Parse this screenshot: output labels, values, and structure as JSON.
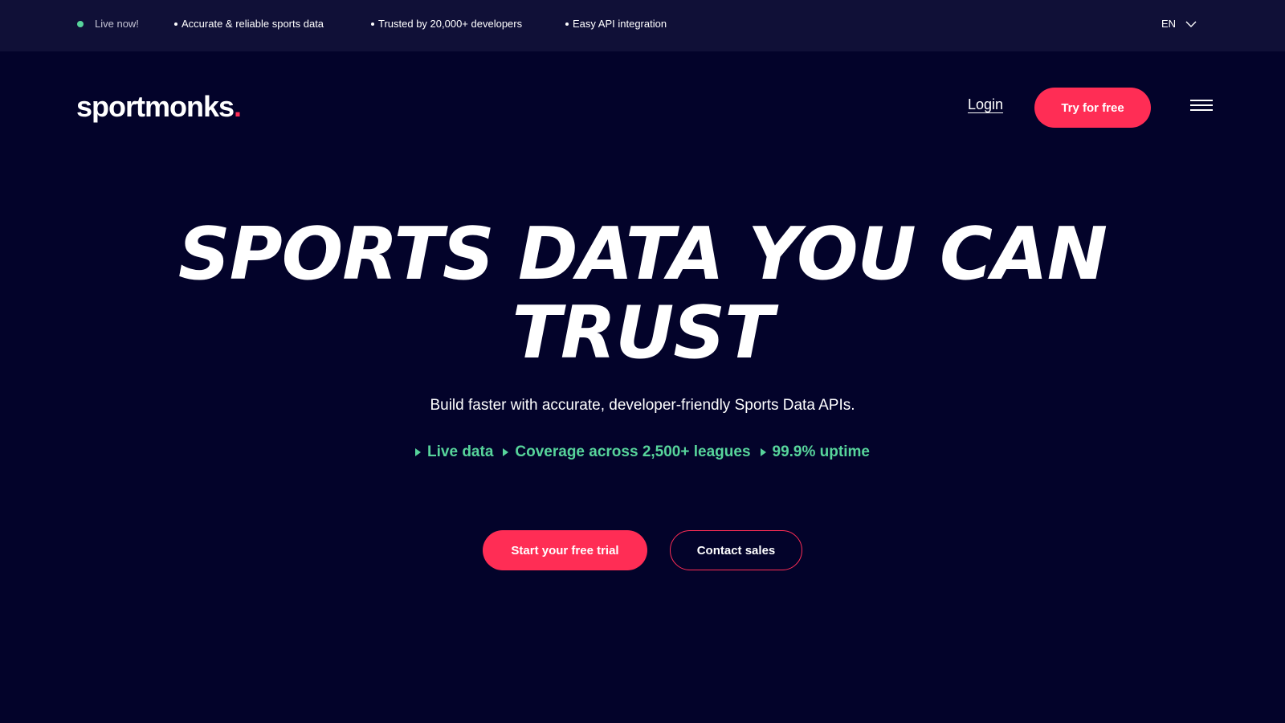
{
  "topbar": {
    "live_label": "Live now!",
    "features": [
      "Accurate & reliable sports data",
      "Trusted by 20,000+ developers",
      "Easy API integration"
    ],
    "language": "EN"
  },
  "nav": {
    "logo_text": "sportmonks",
    "logo_dot": ".",
    "login_label": "Login",
    "try_label": "Try for free"
  },
  "hero": {
    "title_line1": "SPORTS DATA YOU CAN",
    "title_line2": "TRUST",
    "subtitle": "Build faster with accurate, developer-friendly Sports Data APIs.",
    "highlights": [
      "Live data",
      "Coverage across 2,500+ leagues",
      "99.9% uptime"
    ],
    "primary_cta": "Start your free trial",
    "secondary_cta": "Contact sales"
  },
  "colors": {
    "background": "#03032a",
    "topbar": "#101037",
    "accent": "#ff2d55",
    "highlight": "#57d49b"
  },
  "icons": {
    "live_indicator": "live-dot-icon",
    "language_toggle": "chevron-down-icon",
    "menu": "hamburger-menu-icon",
    "highlight_marker": "triangle-right-icon"
  }
}
